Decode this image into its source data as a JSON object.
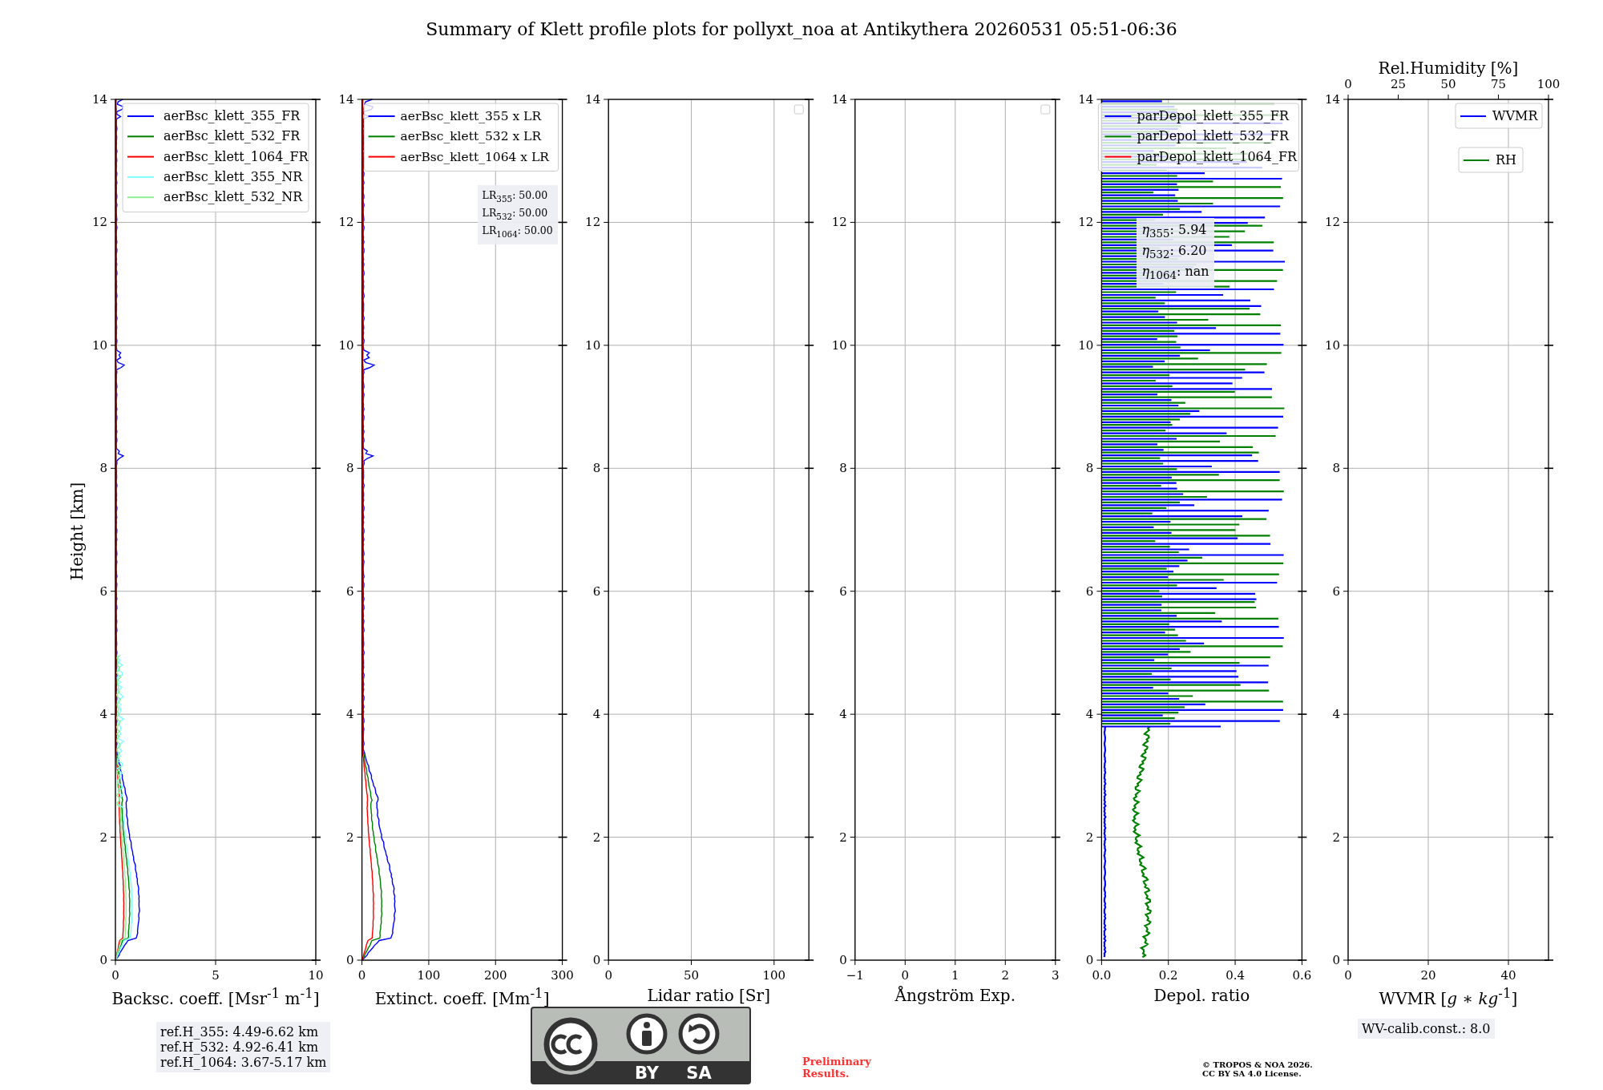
{
  "title": "Summary of Klett profile plots for pollyxt_noa at Antikythera 20260531 05:51-06:36",
  "ylabel": "Height [km]",
  "panels": [
    {
      "kind": "backscatter",
      "xlabel": "Backsc. coeff. [Msr$^{-1}$ m$^{-1}$]",
      "xticks": [
        "0",
        "5",
        "10"
      ],
      "yticks": [
        "14",
        "12",
        "10",
        "8",
        "6",
        "4",
        "2",
        "0"
      ],
      "legend": [
        {
          "label": "aerBsc_klett_355_FR",
          "color": "#0000ff"
        },
        {
          "label": "aerBsc_klett_532_FR",
          "color": "#008000"
        },
        {
          "label": "aerBsc_klett_1064_FR",
          "color": "#ff0000"
        },
        {
          "label": "aerBsc_klett_355_NR",
          "color": "#80ffff"
        },
        {
          "label": "aerBsc_klett_532_NR",
          "color": "#90ee90"
        }
      ]
    },
    {
      "kind": "extinction",
      "xlabel": "Extinct. coeff. [Mm$^{-1}$]",
      "xticks": [
        "0",
        "100",
        "200",
        "300"
      ],
      "yticks": [
        "14",
        "12",
        "10",
        "8",
        "6",
        "4",
        "2",
        "0"
      ],
      "legend": [
        {
          "label": "aerBsc_klett_355 x LR",
          "color": "#0000ff"
        },
        {
          "label": "aerBsc_klett_532 x LR",
          "color": "#008000"
        },
        {
          "label": "aerBsc_klett_1064 x LR",
          "color": "#ff0000"
        }
      ],
      "note": [
        "LR$_{355}$: 50.00",
        "LR$_{532}$: 50.00",
        "LR$_{1064}$: 50.00"
      ]
    },
    {
      "kind": "empty",
      "xlabel": "Lidar ratio [Sr]",
      "xticks": [
        "0",
        "50",
        "100"
      ],
      "yticks": [
        "14",
        "12",
        "10",
        "8",
        "6",
        "4",
        "2",
        "0"
      ]
    },
    {
      "kind": "empty",
      "xlabel": "Ångström Exp.",
      "xticks": [
        "−1",
        "0",
        "1",
        "2",
        "3"
      ],
      "yticks": [
        "14",
        "12",
        "10",
        "8",
        "6",
        "4",
        "2",
        "0"
      ]
    },
    {
      "kind": "depol",
      "xlabel": "Depol. ratio",
      "xticks": [
        "0.0",
        "0.2",
        "0.4",
        "0.6"
      ],
      "yticks": [
        "14",
        "12",
        "10",
        "8",
        "6",
        "4",
        "2",
        "0"
      ],
      "legend": [
        {
          "label": "parDepol_klett_355_FR",
          "color": "#0000ff"
        },
        {
          "label": "parDepol_klett_532_FR",
          "color": "#008000"
        },
        {
          "label": "parDepol_klett_1064_FR",
          "color": "#ff0000"
        }
      ],
      "note": [
        "*η*$_{355}$: 5.94",
        "*η*$_{532}$: 6.20",
        "*η*$_{1064}$: nan"
      ]
    },
    {
      "kind": "wv",
      "xlabel": "WVMR [*g* ∗ *kg*$^{-1}$]",
      "xticks": [
        "0",
        "20",
        "40"
      ],
      "yticks": [
        "14",
        "12",
        "10",
        "8",
        "6",
        "4",
        "2",
        "0"
      ],
      "legend": [
        {
          "label": "WVMR",
          "color": "#0000ff"
        },
        {
          "label": "RH",
          "color": "#008000"
        }
      ],
      "top_axis": {
        "label": "Rel.Humidity [%]",
        "ticks": [
          "0",
          "25",
          "50",
          "75",
          "100"
        ]
      }
    }
  ],
  "ref_heights": [
    "ref.H_355: 4.49-6.62 km",
    "ref.H_532: 4.92-6.41 km",
    "ref.H_1064: 3.67-5.17 km"
  ],
  "license": {
    "by": "BY",
    "sa": "SA"
  },
  "preliminary": [
    "Preliminary",
    "Results."
  ],
  "copyright": [
    "© TROPOS & NOA 2026.",
    "CC BY SA 4.0 License."
  ],
  "wv_calib": "WV-calib.const.: 8.0"
}
